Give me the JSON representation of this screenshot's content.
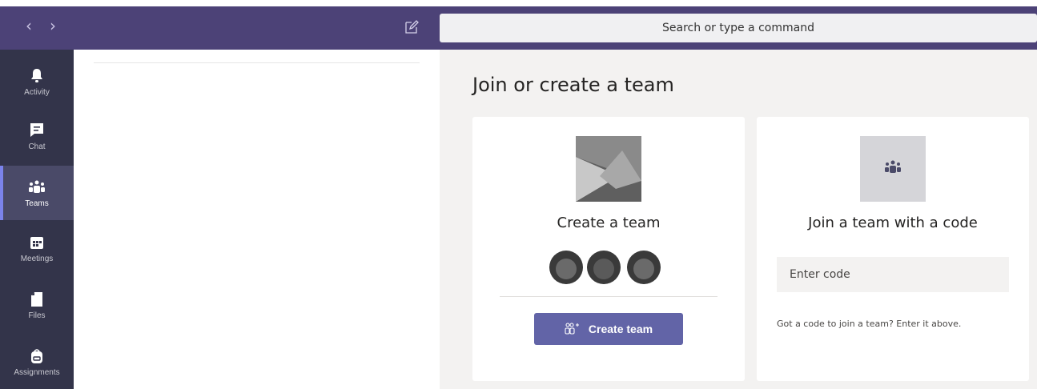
{
  "topbar": {
    "search_placeholder": "Search or type a command",
    "back_icon": "chevron-left-icon",
    "forward_icon": "chevron-right-icon",
    "compose_icon": "compose-icon"
  },
  "colors": {
    "titlebar": "#4c4277",
    "rail": "#33344a",
    "accent": "#6264a7",
    "main_bg": "#f3f2f1"
  },
  "rail": {
    "items": [
      {
        "label": "Activity",
        "icon": "bell-icon",
        "active": false
      },
      {
        "label": "Chat",
        "icon": "chat-icon",
        "active": false
      },
      {
        "label": "Teams",
        "icon": "teams-icon",
        "active": true
      },
      {
        "label": "Meetings",
        "icon": "calendar-icon",
        "active": false
      },
      {
        "label": "Files",
        "icon": "file-icon",
        "active": false
      },
      {
        "label": "Assignments",
        "icon": "backpack-icon",
        "active": false
      }
    ]
  },
  "main": {
    "title": "Join or create a team",
    "create_card": {
      "title": "Create a team",
      "button_label": "Create team"
    },
    "join_card": {
      "title": "Join a team with a code",
      "input_placeholder": "Enter code",
      "hint": "Got a code to join a team? Enter it above."
    }
  }
}
